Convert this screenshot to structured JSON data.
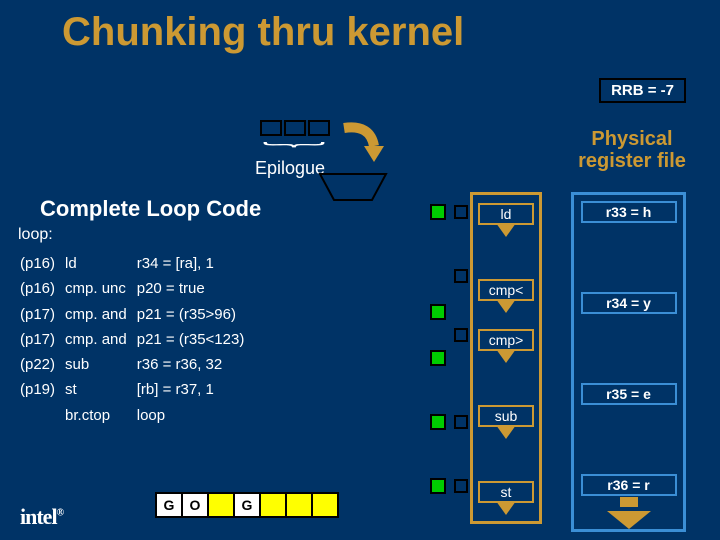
{
  "title": "Chunking thru kernel",
  "rrb": "RRB = -7",
  "phys_label": "Physical register file",
  "epilogue": "Epilogue",
  "complete": "Complete Loop Code",
  "loop_label": "loop:",
  "code": [
    {
      "pred": "(p16)",
      "op": "ld",
      "args": "r34 = [ra], 1"
    },
    {
      "pred": "(p16)",
      "op": "cmp. unc",
      "args": "p20 = true"
    },
    {
      "pred": "(p17)",
      "op": "cmp. and",
      "args": "p21 = (r35>96)"
    },
    {
      "pred": "(p17)",
      "op": "cmp. and",
      "args": "p21 = (r35<123)"
    },
    {
      "pred": "(p22)",
      "op": "sub",
      "args": "r36 = r36, 32"
    },
    {
      "pred": "(p19)",
      "op": "st",
      "args": "[rb] = r37, 1"
    },
    {
      "pred": "",
      "op": "br.ctop",
      "args": "loop"
    }
  ],
  "go": [
    "G",
    "O",
    "",
    "G",
    "",
    "",
    ""
  ],
  "pipe": [
    "ld",
    "cmp<",
    "cmp>",
    "sub",
    "st"
  ],
  "regs": [
    "r33 = h",
    "r34 = y",
    "r35 = e",
    "r36 = r"
  ],
  "intel": "intel",
  "reg_trademark": "®"
}
